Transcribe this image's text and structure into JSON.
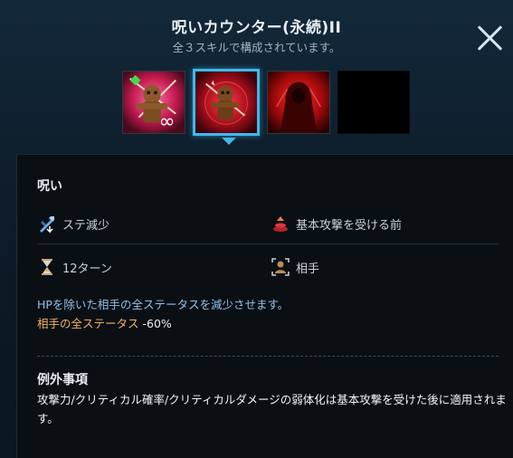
{
  "header": {
    "title": "呪いカウンター(永続)II",
    "subtitle": "全３スキルで構成されています。"
  },
  "skills": [
    {
      "name": "skill-1",
      "icon": "voodoo-doll-infinity-icon",
      "selected": false
    },
    {
      "name": "skill-2",
      "icon": "voodoo-doll-red-icon",
      "selected": true
    },
    {
      "name": "skill-3",
      "icon": "hooded-figure-red-icon",
      "selected": false
    },
    {
      "name": "skill-4",
      "icon": "empty-slot",
      "selected": false
    }
  ],
  "panel": {
    "section_title": "呪い",
    "props": {
      "type_label": "ステ減少",
      "trigger_label": "基本攻撃を受ける前",
      "duration_label": "12ターン",
      "target_label": "相手"
    },
    "description": "HPを除いた相手の全ステータスを減少させます。",
    "effect_label": "相手の全ステータス",
    "effect_value": "-60%",
    "exception_title": "例外事項",
    "exception_text": "攻撃力/クリティカル確率/クリティカルダメージの弱体化は基本攻撃を受けた後に適用されます。"
  },
  "colors": {
    "selected_border": "#3fb8ee",
    "effect_label": "#f0b35a",
    "description": "#8fc0e8"
  }
}
